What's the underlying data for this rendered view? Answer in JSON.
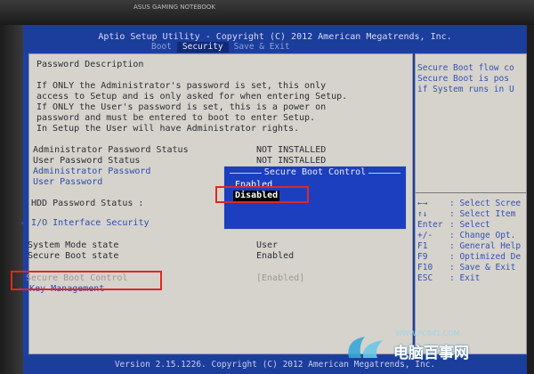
{
  "bezel": {
    "label": "ASUS GAMING NOTEBOOK"
  },
  "header": {
    "title": "Aptio Setup Utility - Copyright (C) 2012 American Megatrends, Inc.",
    "tabs": [
      {
        "label": "Boot",
        "active": false
      },
      {
        "label": "Security",
        "active": true
      },
      {
        "label": "Save & Exit",
        "active": false
      }
    ]
  },
  "main": {
    "section_title": "Password Description",
    "description": [
      "If ONLY the Administrator's password is set, this only",
      "access to Setup and is only asked for when entering Setup.",
      "If ONLY the User's password is set, this is a power on",
      "password and must be entered to boot to enter Setup.",
      "In Setup the User will have Administrator rights."
    ],
    "admin_status_label": "Administrator Password Status",
    "admin_status_value": "NOT INSTALLED",
    "user_status_label": "User Password Status",
    "user_status_value": "NOT INSTALLED",
    "admin_password_link": "Administrator Password",
    "user_password_link": "User Password",
    "hdd_status_label": "HDD Password Status  :",
    "io_security": "I/O Interface Security",
    "system_mode_label": "System Mode state",
    "system_mode_value": "User",
    "secure_boot_state_label": "Secure Boot state",
    "secure_boot_state_value": "Enabled",
    "secure_boot_control_label": "Secure Boot Control",
    "secure_boot_control_value": "[Enabled]",
    "key_management": "Key Management"
  },
  "popup": {
    "title": "Secure Boot Control",
    "options": [
      "Enabled",
      "Disabled"
    ],
    "selected": "Disabled"
  },
  "help": {
    "lines": [
      "Secure Boot flow co",
      "Secure Boot is pos",
      "if System runs in U"
    ],
    "keys": [
      {
        "key": "←→",
        "desc": ": Select Scree"
      },
      {
        "key": "↑↓",
        "desc": ": Select Item"
      },
      {
        "key": "Enter",
        "desc": ": Select"
      },
      {
        "key": "+/-",
        "desc": ": Change Opt."
      },
      {
        "key": "F1",
        "desc": ": General Help"
      },
      {
        "key": "F9",
        "desc": ": Optimized De"
      },
      {
        "key": "F10",
        "desc": ": Save & Exit"
      },
      {
        "key": "ESC",
        "desc": ": Exit"
      }
    ]
  },
  "footer": {
    "text": "Version 2.15.1226. Copyright (C) 2012 American Megatrends, Inc."
  },
  "watermark": {
    "url": "WWW.PC841.COM",
    "name": "电脑百事网"
  },
  "colors": {
    "bios_blue": "#1b3d9c",
    "panel_grey": "#d6d3cc",
    "highlight_red": "#e0281e"
  }
}
